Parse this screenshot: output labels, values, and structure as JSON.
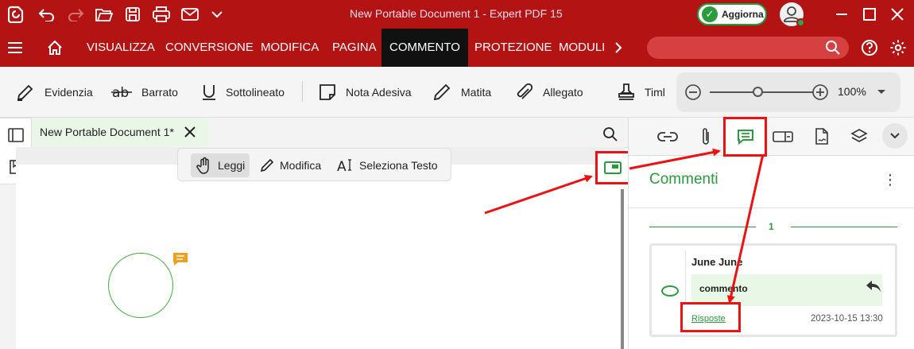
{
  "window": {
    "title": "New Portable Document 1   -   Expert PDF 15",
    "update_button": "Aggiorna"
  },
  "menu": {
    "items": [
      "VISUALIZZA",
      "CONVERSIONE",
      "MODIFICA",
      "PAGINA",
      "COMMENTO",
      "PROTEZIONE",
      "MODULI"
    ],
    "active": "COMMENTO"
  },
  "ribbon": {
    "tools": [
      "Evidenzia",
      "Barrato",
      "Sottolineato",
      "Nota Adesiva",
      "Matita",
      "Allegato",
      "Timl"
    ],
    "zoom": "100%"
  },
  "document": {
    "tab_label": "New Portable Document 1*",
    "floating_tools": [
      "Leggi",
      "Modifica",
      "Seleziona Testo"
    ],
    "active_tool": "Leggi"
  },
  "comments_panel": {
    "title": "Commenti",
    "page_number": "1",
    "comment": {
      "author": "June June",
      "text": "commento",
      "replies_link": "Risposte",
      "date": "2023-10-15 13:30"
    }
  },
  "colors": {
    "brand_red": "#b31313",
    "accent_green": "#2b9c3c",
    "highlight_red": "#e11111"
  }
}
